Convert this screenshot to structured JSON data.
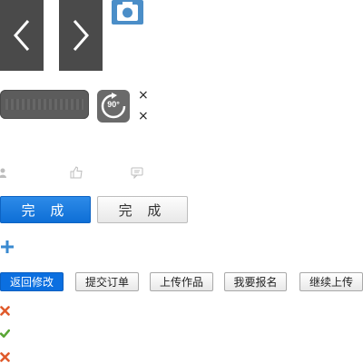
{
  "nav": {
    "prev_icon": "chevron-left-icon",
    "next_icon": "chevron-right-icon",
    "camera_icon": "camera-icon",
    "camera_color": "#4b8ec8"
  },
  "tools": {
    "rotate_label": "90°",
    "close_icon": "close-icon",
    "close_glyph": "×"
  },
  "meta_icons": [
    "user-icon",
    "like-icon",
    "comment-icon"
  ],
  "done_buttons": {
    "primary_label": "完 成",
    "secondary_label": "完 成"
  },
  "add_icon": "plus-icon",
  "actions": [
    {
      "label": "返回修改",
      "style": "primary"
    },
    {
      "label": "提交订单",
      "style": "default"
    },
    {
      "label": "上传作品",
      "style": "default"
    },
    {
      "label": "我要报名",
      "style": "default"
    },
    {
      "label": "继续上传",
      "style": "default"
    }
  ],
  "status_icons": [
    {
      "icon": "cross-icon",
      "color": "#e05a2b"
    },
    {
      "icon": "check-icon",
      "color": "#5aa636"
    },
    {
      "icon": "cross-icon",
      "color": "#e05a2b"
    }
  ],
  "colors": {
    "primary_blue": "#0b6fe0",
    "dark_tile": "#4a4a4a"
  }
}
